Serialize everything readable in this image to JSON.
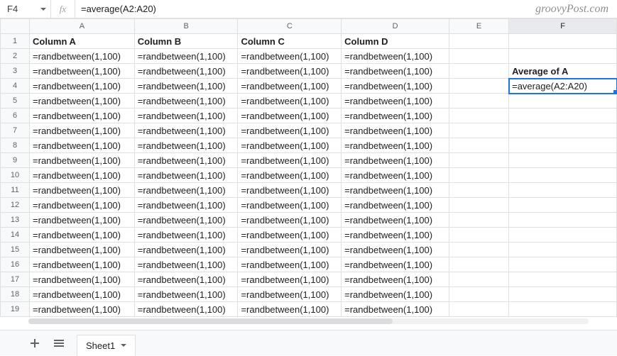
{
  "watermark": "groovyPost.com",
  "formula_bar": {
    "name_box": "F4",
    "fx_label": "fx",
    "formula": "=average(A2:A20)"
  },
  "columns": [
    "A",
    "B",
    "C",
    "D",
    "E",
    "F"
  ],
  "selected_col_index": 5,
  "selected_cell": {
    "row": 4,
    "col": 5
  },
  "rows": [
    {
      "num": 1,
      "cells": [
        "Column A",
        "Column B",
        "Column C",
        "Column D",
        "",
        ""
      ],
      "bold": [
        0,
        1,
        2,
        3
      ]
    },
    {
      "num": 2,
      "cells": [
        "=randbetween(1,100)",
        "=randbetween(1,100)",
        "=randbetween(1,100)",
        "=randbetween(1,100)",
        "",
        ""
      ]
    },
    {
      "num": 3,
      "cells": [
        "=randbetween(1,100)",
        "=randbetween(1,100)",
        "=randbetween(1,100)",
        "=randbetween(1,100)",
        "",
        "Average of A"
      ],
      "bold": [
        5
      ]
    },
    {
      "num": 4,
      "cells": [
        "=randbetween(1,100)",
        "=randbetween(1,100)",
        "=randbetween(1,100)",
        "=randbetween(1,100)",
        "",
        "=average(A2:A20)"
      ]
    },
    {
      "num": 5,
      "cells": [
        "=randbetween(1,100)",
        "=randbetween(1,100)",
        "=randbetween(1,100)",
        "=randbetween(1,100)",
        "",
        ""
      ]
    },
    {
      "num": 6,
      "cells": [
        "=randbetween(1,100)",
        "=randbetween(1,100)",
        "=randbetween(1,100)",
        "=randbetween(1,100)",
        "",
        ""
      ]
    },
    {
      "num": 7,
      "cells": [
        "=randbetween(1,100)",
        "=randbetween(1,100)",
        "=randbetween(1,100)",
        "=randbetween(1,100)",
        "",
        ""
      ]
    },
    {
      "num": 8,
      "cells": [
        "=randbetween(1,100)",
        "=randbetween(1,100)",
        "=randbetween(1,100)",
        "=randbetween(1,100)",
        "",
        ""
      ]
    },
    {
      "num": 9,
      "cells": [
        "=randbetween(1,100)",
        "=randbetween(1,100)",
        "=randbetween(1,100)",
        "=randbetween(1,100)",
        "",
        ""
      ]
    },
    {
      "num": 10,
      "cells": [
        "=randbetween(1,100)",
        "=randbetween(1,100)",
        "=randbetween(1,100)",
        "=randbetween(1,100)",
        "",
        ""
      ]
    },
    {
      "num": 11,
      "cells": [
        "=randbetween(1,100)",
        "=randbetween(1,100)",
        "=randbetween(1,100)",
        "=randbetween(1,100)",
        "",
        ""
      ]
    },
    {
      "num": 12,
      "cells": [
        "=randbetween(1,100)",
        "=randbetween(1,100)",
        "=randbetween(1,100)",
        "=randbetween(1,100)",
        "",
        ""
      ]
    },
    {
      "num": 13,
      "cells": [
        "=randbetween(1,100)",
        "=randbetween(1,100)",
        "=randbetween(1,100)",
        "=randbetween(1,100)",
        "",
        ""
      ]
    },
    {
      "num": 14,
      "cells": [
        "=randbetween(1,100)",
        "=randbetween(1,100)",
        "=randbetween(1,100)",
        "=randbetween(1,100)",
        "",
        ""
      ]
    },
    {
      "num": 15,
      "cells": [
        "=randbetween(1,100)",
        "=randbetween(1,100)",
        "=randbetween(1,100)",
        "=randbetween(1,100)",
        "",
        ""
      ]
    },
    {
      "num": 16,
      "cells": [
        "=randbetween(1,100)",
        "=randbetween(1,100)",
        "=randbetween(1,100)",
        "=randbetween(1,100)",
        "",
        ""
      ]
    },
    {
      "num": 17,
      "cells": [
        "=randbetween(1,100)",
        "=randbetween(1,100)",
        "=randbetween(1,100)",
        "=randbetween(1,100)",
        "",
        ""
      ]
    },
    {
      "num": 18,
      "cells": [
        "=randbetween(1,100)",
        "=randbetween(1,100)",
        "=randbetween(1,100)",
        "=randbetween(1,100)",
        "",
        ""
      ]
    },
    {
      "num": 19,
      "cells": [
        "=randbetween(1,100)",
        "=randbetween(1,100)",
        "=randbetween(1,100)",
        "=randbetween(1,100)",
        "",
        ""
      ]
    }
  ],
  "sheet_tab": "Sheet1"
}
